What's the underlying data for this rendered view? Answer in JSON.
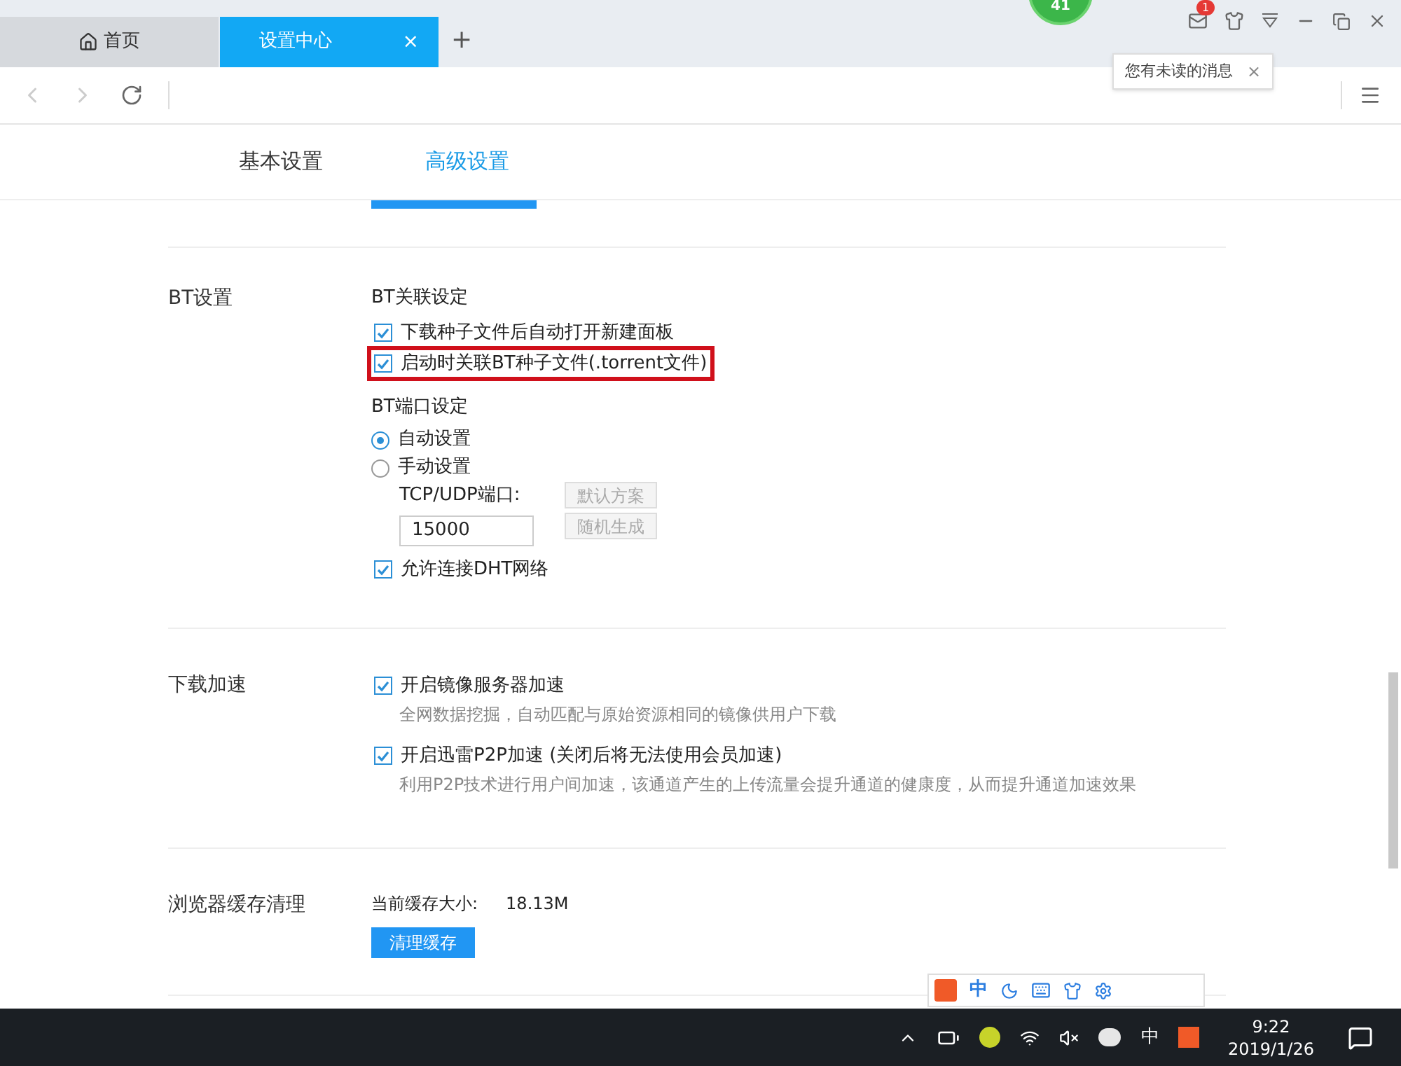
{
  "tabs": [
    {
      "label": "首页",
      "selected": false
    },
    {
      "label": "设置中心",
      "selected": true,
      "close": "×"
    }
  ],
  "new_tab": "+",
  "floating_badge": "41",
  "notification": {
    "badge": "1",
    "tooltip": "您有未读的消息",
    "close": "×"
  },
  "settings_tabs": [
    {
      "label": "基本设置",
      "selected": false
    },
    {
      "label": "高级设置",
      "selected": true
    }
  ],
  "sections": [
    {
      "title": "BT设置",
      "items": [
        {
          "kind": "heading",
          "text": "BT关联设定"
        },
        {
          "kind": "checkbox",
          "label": "下载种子文件后自动打开新建面板",
          "checked": true,
          "highlighted": false
        },
        {
          "kind": "checkbox",
          "label": "启动时关联BT种子文件(.torrent文件)",
          "checked": true,
          "highlighted": true
        },
        {
          "kind": "heading",
          "text": "BT端口设定"
        },
        {
          "kind": "radio",
          "label": "自动设置",
          "selected": true
        },
        {
          "kind": "radio",
          "label": "手动设置",
          "selected": false
        },
        {
          "kind": "port",
          "label": "TCP/UDP端口:",
          "value": "15000",
          "buttons": [
            {
              "label": "默认方案",
              "disabled": true
            },
            {
              "label": "随机生成",
              "disabled": true
            }
          ]
        },
        {
          "kind": "checkbox",
          "label": "允许连接DHT网络",
          "checked": true,
          "highlighted": false
        }
      ]
    },
    {
      "title": "下载加速",
      "items": [
        {
          "kind": "checkbox",
          "label": "开启镜像服务器加速",
          "checked": true,
          "highlighted": false
        },
        {
          "kind": "hint",
          "text": "全网数据挖掘，自动匹配与原始资源相同的镜像供用户下载"
        },
        {
          "kind": "checkbox",
          "label": "开启迅雷P2P加速 (关闭后将无法使用会员加速)",
          "checked": true,
          "highlighted": false
        },
        {
          "kind": "hint",
          "text": "利用P2P技术进行用户间加速，该通道产生的上传流量会提升通道的健康度，从而提升通道加速效果"
        }
      ]
    },
    {
      "title": "浏览器缓存清理",
      "items": [
        {
          "kind": "info",
          "label": "当前缓存大小:",
          "value": "18.13M"
        },
        {
          "kind": "button",
          "label": "清理缓存"
        }
      ]
    }
  ],
  "ime_toolbar": {
    "mode": "中"
  },
  "taskbar": {
    "ime": "中",
    "time": "9:22",
    "date": "2019/1/26"
  }
}
